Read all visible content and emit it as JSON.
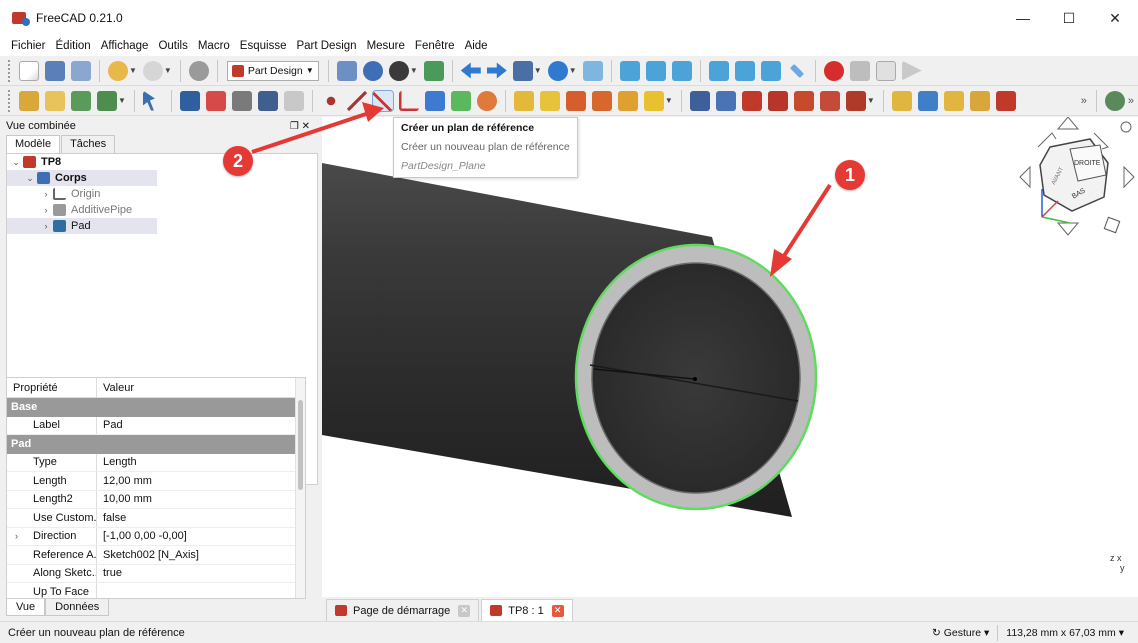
{
  "window": {
    "title": "FreeCAD 0.21.0",
    "minimize": "—",
    "maximize": "☐",
    "close": "✕"
  },
  "menu": [
    "Fichier",
    "Édition",
    "Affichage",
    "Outils",
    "Macro",
    "Esquisse",
    "Part Design",
    "Mesure",
    "Fenêtre",
    "Aide"
  ],
  "toolbar": {
    "workbench": "Part Design",
    "colors": {
      "accent": "#e53935",
      "highlight": "#6fd36f"
    }
  },
  "combo_view": {
    "title": "Vue combinée",
    "header_controls": "❐  ✕",
    "tabs": [
      "Modèle",
      "Tâches"
    ],
    "tree": [
      {
        "label": "TP8",
        "bold": true
      },
      {
        "label": "Corps",
        "bold": true
      },
      {
        "label": "Origin"
      },
      {
        "label": "AdditivePipe"
      },
      {
        "label": "Pad"
      }
    ]
  },
  "properties": {
    "col_name": "Propriété",
    "col_value": "Valeur",
    "groups": [
      {
        "name": "Base",
        "rows": [
          {
            "name": "Label",
            "value": "Pad"
          }
        ]
      },
      {
        "name": "Pad",
        "rows": [
          {
            "name": "Type",
            "value": "Length"
          },
          {
            "name": "Length",
            "value": "12,00 mm"
          },
          {
            "name": "Length2",
            "value": "10,00 mm"
          },
          {
            "name": "Use Custom...",
            "value": "false"
          },
          {
            "name": "Direction",
            "value": "[-1,00 0,00 -0,00]"
          },
          {
            "name": "Reference A...",
            "value": "Sketch002 [N_Axis]"
          },
          {
            "name": "Along Sketc...",
            "value": "true"
          },
          {
            "name": "Up To Face",
            "value": ""
          }
        ]
      }
    ]
  },
  "bottom_tabs": [
    "Vue",
    "Données"
  ],
  "tooltip": {
    "title": "Créer un plan de référence",
    "description": "Créer un nouveau plan de référence",
    "command": "PartDesign_Plane"
  },
  "markers": [
    "1",
    "2"
  ],
  "navcube": {
    "face_right": "DROITE",
    "face_bottom": "BAS",
    "face_front": "AVANT"
  },
  "doc_tabs": [
    {
      "label": "Page de démarrage",
      "active": false
    },
    {
      "label": "TP8 : 1",
      "active": true
    }
  ],
  "status": {
    "message": "Créer un nouveau plan de référence",
    "nav_style": "Gesture",
    "dimensions": "113,28 mm x 67,03 mm"
  },
  "axis_labels": {
    "z": "z",
    "x": "x",
    "y": "y"
  }
}
